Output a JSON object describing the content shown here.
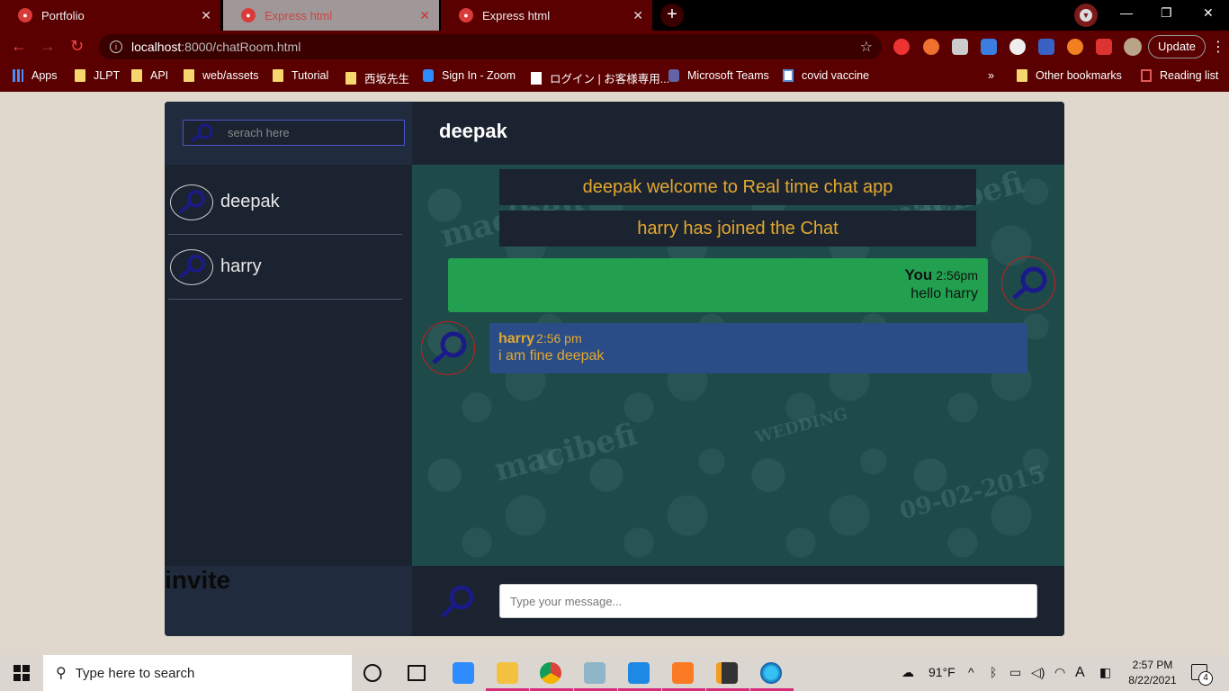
{
  "browser": {
    "tabs": [
      {
        "title": "Portfolio"
      },
      {
        "title": "Express html"
      },
      {
        "title": "Express html"
      }
    ],
    "url_host": "localhost",
    "url_rest": ":8000/chatRoom.html",
    "update_label": "Update",
    "bookmarks": [
      {
        "label": "Apps"
      },
      {
        "label": "JLPT"
      },
      {
        "label": "API"
      },
      {
        "label": "web/assets"
      },
      {
        "label": "Tutorial"
      },
      {
        "label": "西坂先生"
      },
      {
        "label": "Sign In - Zoom"
      },
      {
        "label": "ログイン | お客様専用..."
      },
      {
        "label": "Microsoft Teams"
      },
      {
        "label": "covid vaccine"
      },
      {
        "label": "Other bookmarks"
      },
      {
        "label": "Reading list"
      }
    ],
    "overflow_label": "»"
  },
  "sidebar": {
    "search_placeholder": "serach here",
    "contacts": [
      {
        "name": "deepak"
      },
      {
        "name": "harry"
      }
    ],
    "invite_label": "invite"
  },
  "chat": {
    "title": "deepak",
    "system_messages": [
      "deepak welcome to Real time chat app",
      "harry has joined the Chat"
    ],
    "outgoing": {
      "who": "You",
      "time": "2:56pm",
      "text": "hello harry"
    },
    "incoming": {
      "who": "harry",
      "time": "2:56 pm",
      "text": "i am fine deepak"
    },
    "input_placeholder": "Type your message...",
    "watermarks": [
      "macibefi",
      "macibefi",
      "macibefi",
      "09-02-2015",
      "WEDDING"
    ]
  },
  "taskbar": {
    "search_placeholder": "Type here to search",
    "weather": "91°F",
    "time": "2:57 PM",
    "date": "8/22/2021",
    "notification_count": "4"
  },
  "colors": {
    "sysmsg_text": "#e3a82e",
    "outgoing_bubble": "#22a050",
    "incoming_bubble": "#2a4d88",
    "search_border": "#4a52c8",
    "sidebar_bg": "#1b2331",
    "panel_bg": "#202c3d",
    "chat_bg": "#1f4a4a"
  }
}
